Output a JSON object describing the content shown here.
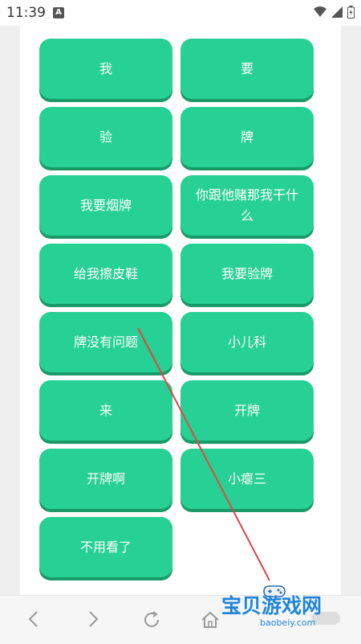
{
  "status": {
    "time": "11:39"
  },
  "buttons": [
    {
      "label": "我"
    },
    {
      "label": "要"
    },
    {
      "label": "验"
    },
    {
      "label": "牌"
    },
    {
      "label": "我要烟牌"
    },
    {
      "label": "你跟他赌那我干什么"
    },
    {
      "label": "给我擦皮鞋"
    },
    {
      "label": "我要验牌"
    },
    {
      "label": "牌没有问题"
    },
    {
      "label": "小儿科"
    },
    {
      "label": "来"
    },
    {
      "label": "开牌"
    },
    {
      "label": "开牌啊"
    },
    {
      "label": "小瘪三"
    },
    {
      "label": "不用看了"
    }
  ],
  "watermark": {
    "title": "宝贝游戏网",
    "url": "baobeiy.com"
  },
  "colors": {
    "tile": "#27d094",
    "tile_shadow": "#1a9a6b",
    "annotation": "#e04545"
  }
}
